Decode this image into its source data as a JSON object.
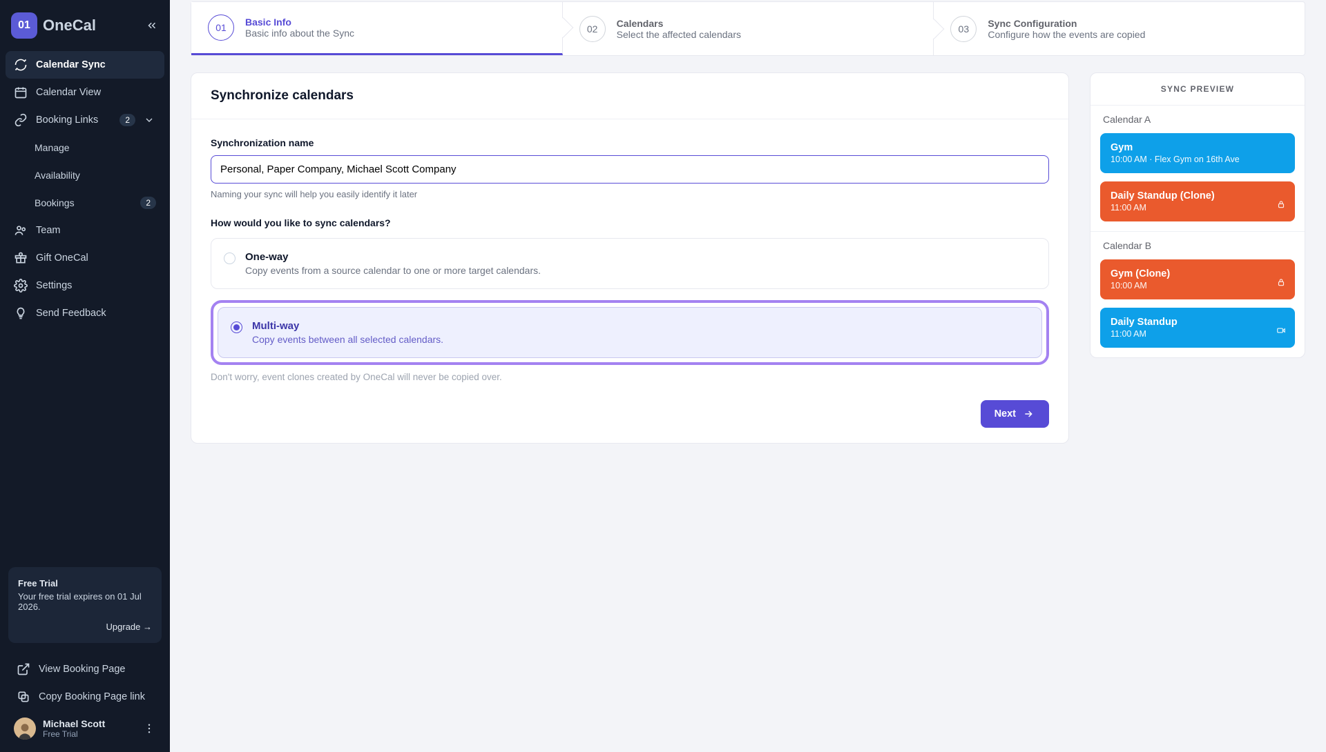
{
  "brand": {
    "badge": "01",
    "name": "OneCal"
  },
  "sidebar": {
    "items": [
      {
        "label": "Calendar Sync"
      },
      {
        "label": "Calendar View"
      },
      {
        "label": "Booking Links",
        "badge": "2"
      },
      {
        "label": "Manage"
      },
      {
        "label": "Availability"
      },
      {
        "label": "Bookings",
        "badge": "2"
      },
      {
        "label": "Team"
      },
      {
        "label": "Gift OneCal"
      },
      {
        "label": "Settings"
      },
      {
        "label": "Send Feedback"
      }
    ],
    "trial": {
      "title": "Free Trial",
      "body": "Your free trial expires on 01 Jul 2026.",
      "upgrade": "Upgrade →"
    },
    "footer": [
      {
        "label": "View Booking Page"
      },
      {
        "label": "Copy Booking Page link"
      }
    ],
    "user": {
      "name": "Michael Scott",
      "status": "Free Trial"
    }
  },
  "stepper": [
    {
      "num": "01",
      "title": "Basic Info",
      "sub": "Basic info about the Sync"
    },
    {
      "num": "02",
      "title": "Calendars",
      "sub": "Select the affected calendars"
    },
    {
      "num": "03",
      "title": "Sync Configuration",
      "sub": "Configure how the events are copied"
    }
  ],
  "form": {
    "heading": "Synchronize calendars",
    "name_label": "Synchronization name",
    "name_value": "Personal, Paper Company, Michael Scott Company",
    "name_help": "Naming your sync will help you easily identify it later",
    "question": "How would you like to sync calendars?",
    "options": [
      {
        "title": "One-way",
        "desc": "Copy events from a source calendar to one or more target calendars."
      },
      {
        "title": "Multi-way",
        "desc": "Copy events between all selected calendars."
      }
    ],
    "note": "Don't worry, event clones created by OneCal will never be copied over.",
    "next": "Next"
  },
  "preview": {
    "title": "SYNC PREVIEW",
    "calendars": [
      {
        "name": "Calendar A",
        "events": [
          {
            "title": "Gym",
            "sub": "10:00 AM · Flex Gym on 16th Ave",
            "color": "blue",
            "icon": "none"
          },
          {
            "title": "Daily Standup (Clone)",
            "sub": "11:00 AM",
            "color": "orange",
            "icon": "lock"
          }
        ]
      },
      {
        "name": "Calendar B",
        "events": [
          {
            "title": "Gym (Clone)",
            "sub": "10:00 AM",
            "color": "orange",
            "icon": "lock"
          },
          {
            "title": "Daily Standup",
            "sub": "11:00 AM",
            "color": "blue",
            "icon": "video"
          }
        ]
      }
    ]
  }
}
